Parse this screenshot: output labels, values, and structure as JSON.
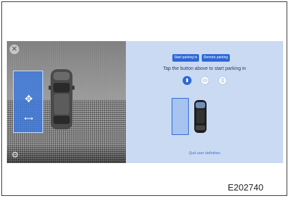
{
  "camera": {
    "close_icon": "close-icon",
    "settings_icon": "gear-icon",
    "move_icon": "move-arrows-icon",
    "rotate_icon": "rotate-icon"
  },
  "panel": {
    "start_label": "Start parking in",
    "remote_label": "Remote parking",
    "instruction": "Tap the button above to start parking in",
    "modes": [
      {
        "icon": "parking-mode-1-icon",
        "active": true
      },
      {
        "icon": "parking-mode-2-icon",
        "active": false
      },
      {
        "icon": "parking-mode-3-icon",
        "active": false
      }
    ],
    "quit_label": "Quit user definition"
  },
  "figure_code": "E202740",
  "colors": {
    "accent": "#2f68d6",
    "panel_bg": "#c9daf2",
    "slot_fill": "#407adc"
  }
}
